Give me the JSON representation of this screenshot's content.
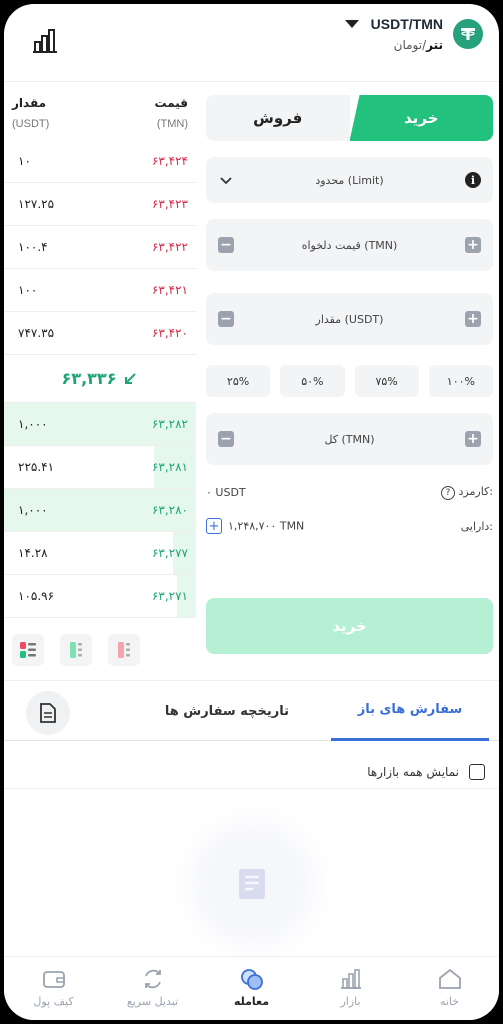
{
  "header": {
    "pair": "USDT/TMN",
    "sub_bold": "تتر",
    "sub_rest": "/تومان"
  },
  "book": {
    "price_label": "قیمت",
    "amount_label": "مقدار",
    "price_unit": "(TMN)",
    "amount_unit": "(USDT)",
    "asks": [
      {
        "price": "۶۳,۴۲۴",
        "amount": "۱۰",
        "depth": 0.0
      },
      {
        "price": "۶۳,۴۲۳",
        "amount": "۱۲۷.۲۵",
        "depth": 0.0
      },
      {
        "price": "۶۳,۴۲۲",
        "amount": "۱۰۰.۴",
        "depth": 0.0
      },
      {
        "price": "۶۳,۴۲۱",
        "amount": "۱۰۰",
        "depth": 0.0
      },
      {
        "price": "۶۳,۴۲۰",
        "amount": "۷۴۷.۳۵",
        "depth": 0.0
      }
    ],
    "last_price": "۶۳,۳۳۶",
    "bids": [
      {
        "price": "۶۳,۲۸۲",
        "amount": "۱,۰۰۰",
        "depth": 1.0
      },
      {
        "price": "۶۳,۲۸۱",
        "amount": "۲۲۵.۴۱",
        "depth": 0.22
      },
      {
        "price": "۶۳,۲۸۰",
        "amount": "۱,۰۰۰",
        "depth": 1.0
      },
      {
        "price": "۶۳,۲۷۷",
        "amount": "۱۴.۲۸",
        "depth": 0.12
      },
      {
        "price": "۶۳,۲۷۱",
        "amount": "۱۰۵.۹۶",
        "depth": 0.1
      }
    ]
  },
  "form": {
    "buy_tab": "خرید",
    "sell_tab": "فروش",
    "order_type": "محدود (Limit)",
    "price_field": "قیمت دلخواه (TMN)",
    "amount_field": "مقدار (USDT)",
    "percents": [
      "۲۵%",
      "۵۰%",
      "۷۵%",
      "۱۰۰%"
    ],
    "total_field": "کل (TMN)",
    "fee_label": "کارمزد:",
    "fee_value": "۰ USDT",
    "asset_label": "دارایی:",
    "asset_value": "۱,۲۴۸,۷۰۰ TMN",
    "submit": "خرید"
  },
  "orders": {
    "open_tab": "سفارش های باز",
    "history_tab": "تاریخچه سفارش ها",
    "all_markets": "نمایش همه بازارها"
  },
  "nav": {
    "home": "خانه",
    "market": "بازار",
    "trade": "معامله",
    "swap": "تبدیل سریع",
    "wallet": "کیف پول"
  },
  "colors": {
    "buy_green": "#22c17e",
    "sell_red": "#d32f4a",
    "accent_blue": "#3b6fd8"
  }
}
